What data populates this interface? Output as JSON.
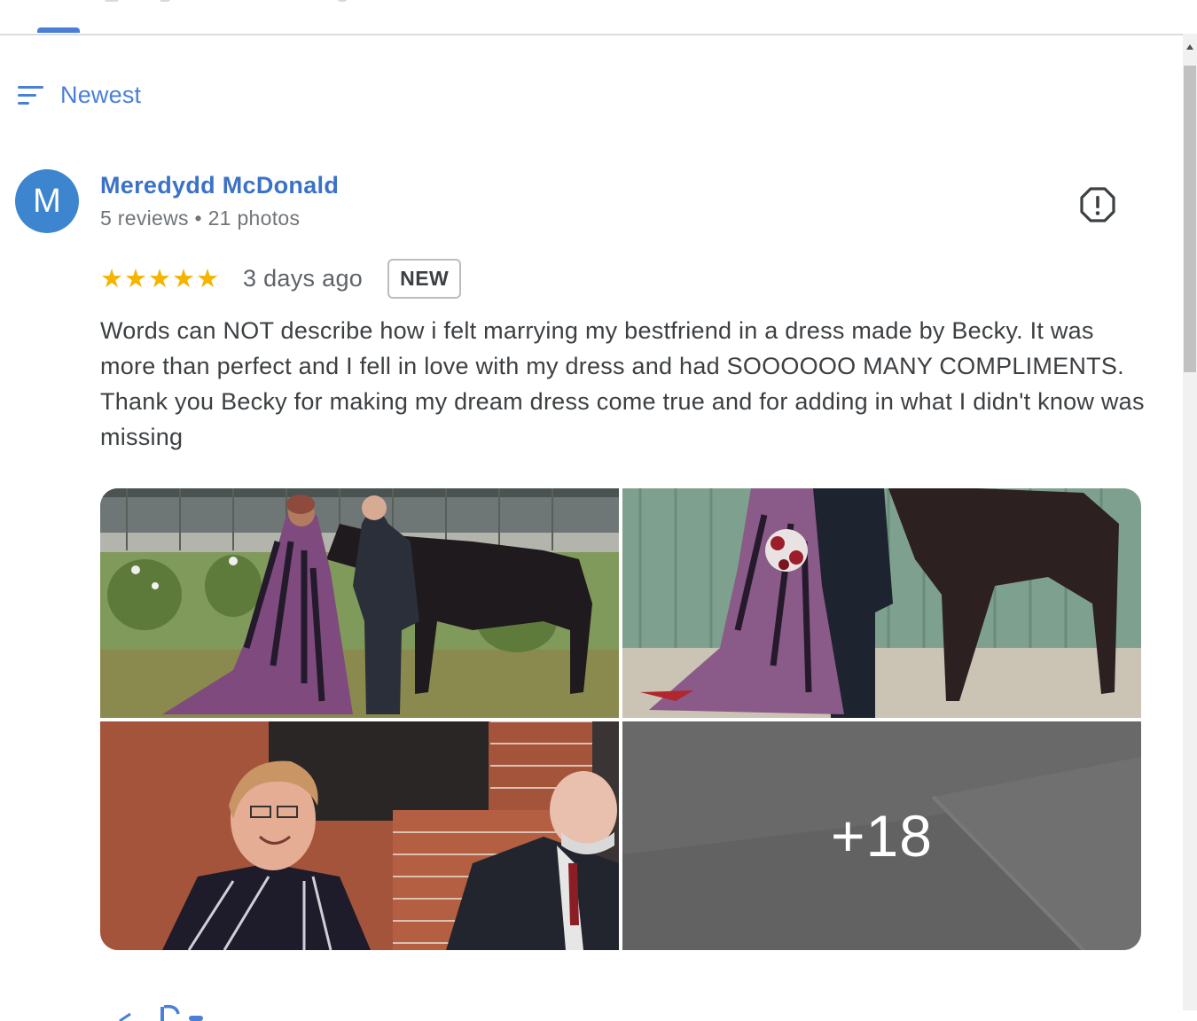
{
  "colors": {
    "accent": "#4a7fd8",
    "star": "#f4b400",
    "avatar_bg": "#3d86cf"
  },
  "sort": {
    "icon": "sort-lines-icon",
    "label": "Newest"
  },
  "review": {
    "avatar_letter": "M",
    "reviewer_name": "Meredydd McDonald",
    "reviewer_meta": "5 reviews • 21 photos",
    "rating": 5,
    "stars": "★★★★★",
    "date": "3 days ago",
    "badge": "NEW",
    "report_icon": "report-exclamation-icon",
    "text": "Words can NOT describe how i felt marrying my bestfriend in a dress made by Becky. It was more than perfect and I fell in love with my dress and had SOOOOOO MANY COMPLIMENTS. Thank you Becky for making my dream dress come true and for adding in what I didn't know was missing",
    "photos": {
      "more_count": "+18"
    }
  }
}
